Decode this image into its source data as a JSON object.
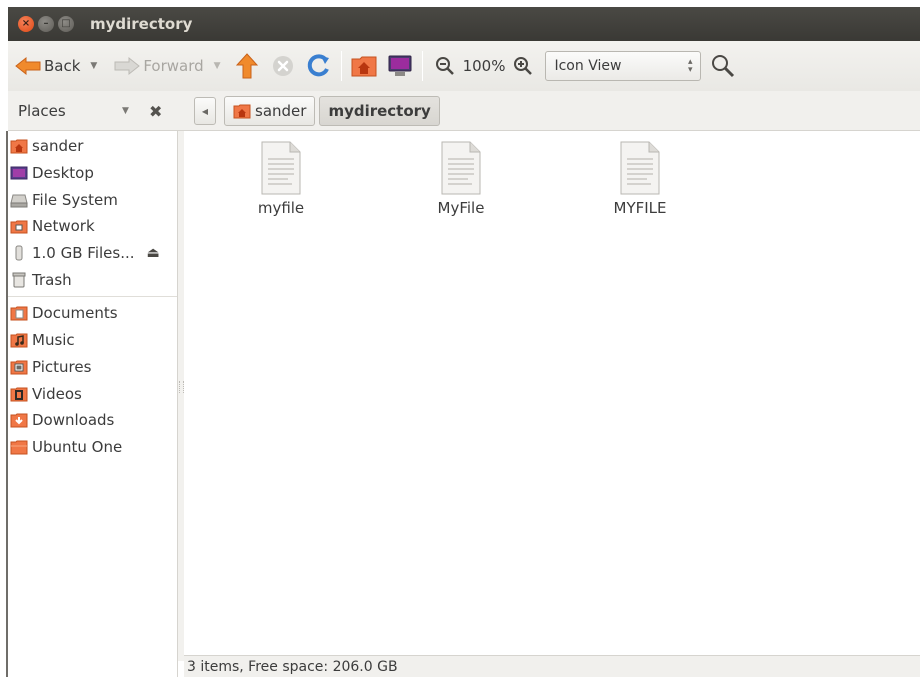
{
  "window": {
    "title": "mydirectory",
    "close_glyph": "×",
    "minimize_glyph": "–",
    "maximize_glyph": "□"
  },
  "toolbar": {
    "back_label": "Back",
    "forward_label": "Forward",
    "zoom_level": "100%",
    "view_mode": "Icon View",
    "icons": [
      "back-arrow-icon",
      "forward-arrow-icon",
      "up-arrow-icon",
      "stop-icon",
      "reload-icon",
      "home-folder-icon",
      "computer-icon",
      "zoom-out-icon",
      "zoom-in-icon",
      "search-icon"
    ]
  },
  "places": {
    "header": "Places"
  },
  "location": {
    "crumbs": [
      "sander",
      "mydirectory"
    ]
  },
  "sidebar": {
    "devices": [
      {
        "label": "sander",
        "icon": "home-folder-icon"
      },
      {
        "label": "Desktop",
        "icon": "desktop-icon"
      },
      {
        "label": "File System",
        "icon": "harddisk-icon"
      },
      {
        "label": "Network",
        "icon": "network-icon"
      },
      {
        "label": "1.0 GB Files...",
        "icon": "usb-drive-icon"
      },
      {
        "label": "Trash",
        "icon": "trash-icon"
      }
    ],
    "bookmarks": [
      {
        "label": "Documents",
        "icon": "documents-folder-icon"
      },
      {
        "label": "Music",
        "icon": "music-folder-icon"
      },
      {
        "label": "Pictures",
        "icon": "pictures-folder-icon"
      },
      {
        "label": "Videos",
        "icon": "videos-folder-icon"
      },
      {
        "label": "Downloads",
        "icon": "downloads-folder-icon"
      },
      {
        "label": "Ubuntu One",
        "icon": "ubuntu-one-folder-icon"
      }
    ]
  },
  "files": [
    {
      "name": "myfile",
      "icon": "text-file-icon"
    },
    {
      "name": "MyFile",
      "icon": "text-file-icon"
    },
    {
      "name": "MYFILE",
      "icon": "text-file-icon"
    }
  ],
  "status": {
    "text": "3 items, Free space: 206.0 GB"
  },
  "colors": {
    "titlebar": "#3c3b37",
    "close_button": "#dd4814",
    "folder_orange": "#f07746",
    "accent_red": "#df421e"
  }
}
